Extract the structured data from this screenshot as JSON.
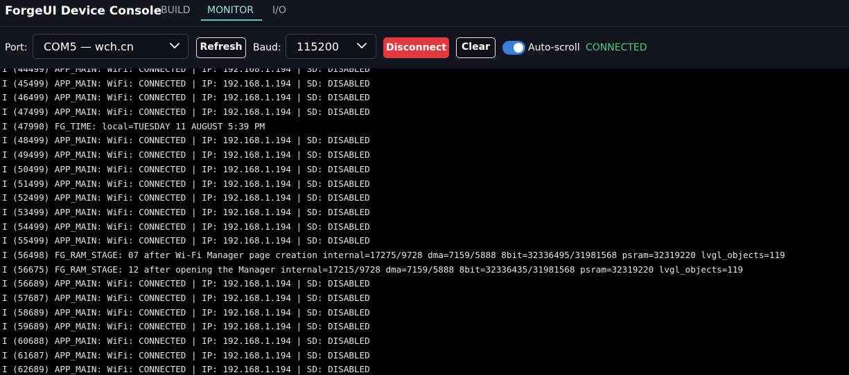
{
  "header": {
    "app_title": "ForgeUI Device Console",
    "tabs": [
      {
        "label": "BUILD",
        "active": false
      },
      {
        "label": "MONITOR",
        "active": true
      },
      {
        "label": "I/O",
        "active": false
      }
    ]
  },
  "toolbar": {
    "port_label": "Port:",
    "port_value": "COM5 — wch.cn",
    "refresh_label": "Refresh",
    "baud_label": "Baud:",
    "baud_value": "115200",
    "disconnect_label": "Disconnect",
    "clear_label": "Clear",
    "autoscroll_label": "Auto-scroll",
    "autoscroll_on": true,
    "status_text": "CONNECTED"
  },
  "colors": {
    "accent_tab": "#9fe3e2",
    "status_connected": "#4fcf82",
    "danger": "#e2393f",
    "toggle_on": "#3a7fd8"
  },
  "icons": {
    "port_dropdown": "chevron-down-icon",
    "baud_dropdown": "chevron-down-icon"
  },
  "log": {
    "lines": [
      "I (44499) APP_MAIN: WiFi: CONNECTED | IP: 192.168.1.194 | SD: DISABLED",
      "I (45499) APP_MAIN: WiFi: CONNECTED | IP: 192.168.1.194 | SD: DISABLED",
      "I (46499) APP_MAIN: WiFi: CONNECTED | IP: 192.168.1.194 | SD: DISABLED",
      "I (47499) APP_MAIN: WiFi: CONNECTED | IP: 192.168.1.194 | SD: DISABLED",
      "I (47990) FG_TIME: local=TUESDAY 11 AUGUST 5:39 PM",
      "I (48499) APP_MAIN: WiFi: CONNECTED | IP: 192.168.1.194 | SD: DISABLED",
      "I (49499) APP_MAIN: WiFi: CONNECTED | IP: 192.168.1.194 | SD: DISABLED",
      "I (50499) APP_MAIN: WiFi: CONNECTED | IP: 192.168.1.194 | SD: DISABLED",
      "I (51499) APP_MAIN: WiFi: CONNECTED | IP: 192.168.1.194 | SD: DISABLED",
      "I (52499) APP_MAIN: WiFi: CONNECTED | IP: 192.168.1.194 | SD: DISABLED",
      "I (53499) APP_MAIN: WiFi: CONNECTED | IP: 192.168.1.194 | SD: DISABLED",
      "I (54499) APP_MAIN: WiFi: CONNECTED | IP: 192.168.1.194 | SD: DISABLED",
      "I (55499) APP_MAIN: WiFi: CONNECTED | IP: 192.168.1.194 | SD: DISABLED",
      "I (56498) FG_RAM_STAGE: 07 after Wi-Fi Manager page creation internal=17275/9728 dma=7159/5888 8bit=32336495/31981568 psram=32319220 lvgl_objects=119",
      "I (56675) FG_RAM_STAGE: 12 after opening the Manager internal=17215/9728 dma=7159/5888 8bit=32336435/31981568 psram=32319220 lvgl_objects=119",
      "I (56689) APP_MAIN: WiFi: CONNECTED | IP: 192.168.1.194 | SD: DISABLED",
      "I (57687) APP_MAIN: WiFi: CONNECTED | IP: 192.168.1.194 | SD: DISABLED",
      "I (58689) APP_MAIN: WiFi: CONNECTED | IP: 192.168.1.194 | SD: DISABLED",
      "I (59689) APP_MAIN: WiFi: CONNECTED | IP: 192.168.1.194 | SD: DISABLED",
      "I (60688) APP_MAIN: WiFi: CONNECTED | IP: 192.168.1.194 | SD: DISABLED",
      "I (61687) APP_MAIN: WiFi: CONNECTED | IP: 192.168.1.194 | SD: DISABLED",
      "I (62689) APP_MAIN: WiFi: CONNECTED | IP: 192.168.1.194 | SD: DISABLED"
    ]
  }
}
